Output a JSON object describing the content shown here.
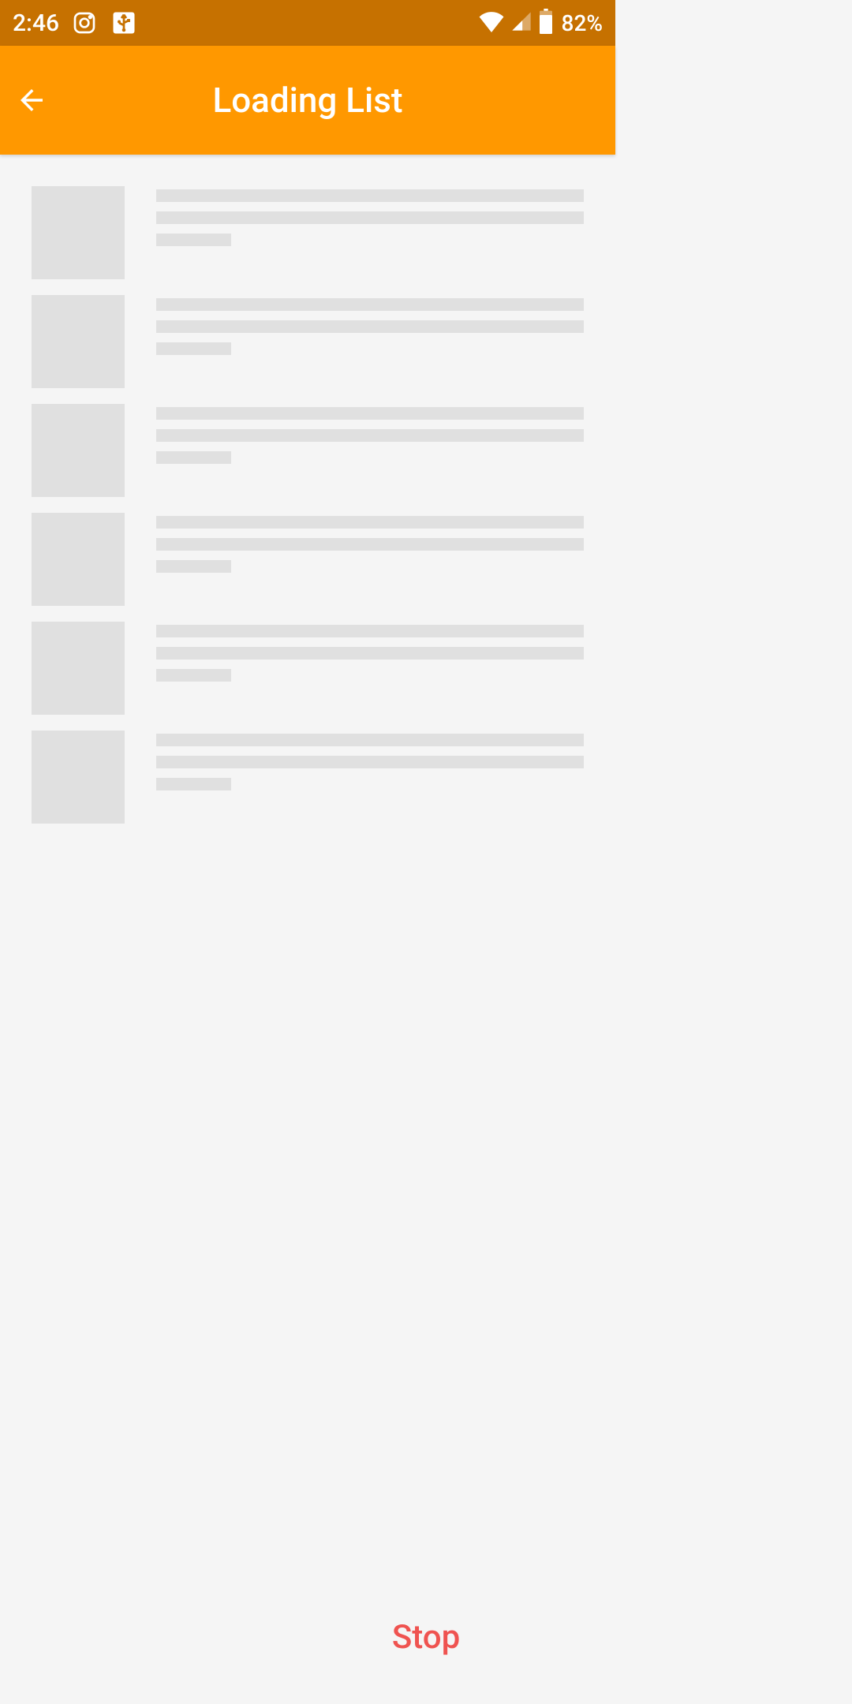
{
  "status_bar": {
    "time": "2:46",
    "battery_percent": "82%",
    "icons": {
      "instagram": "instagram-icon",
      "usb": "usb-icon",
      "wifi": "wifi-icon",
      "signal": "signal-icon",
      "battery": "battery-icon"
    }
  },
  "app_bar": {
    "title": "Loading List",
    "back_icon": "back-arrow-icon"
  },
  "skeleton": {
    "item_count": 6
  },
  "actions": {
    "stop_label": "Stop"
  },
  "colors": {
    "status_bar_bg": "#c67100",
    "app_bar_bg": "#ff9800",
    "skeleton_fill": "#e0e0e0",
    "stop_color": "#ef5350",
    "page_bg": "#f5f5f5"
  }
}
